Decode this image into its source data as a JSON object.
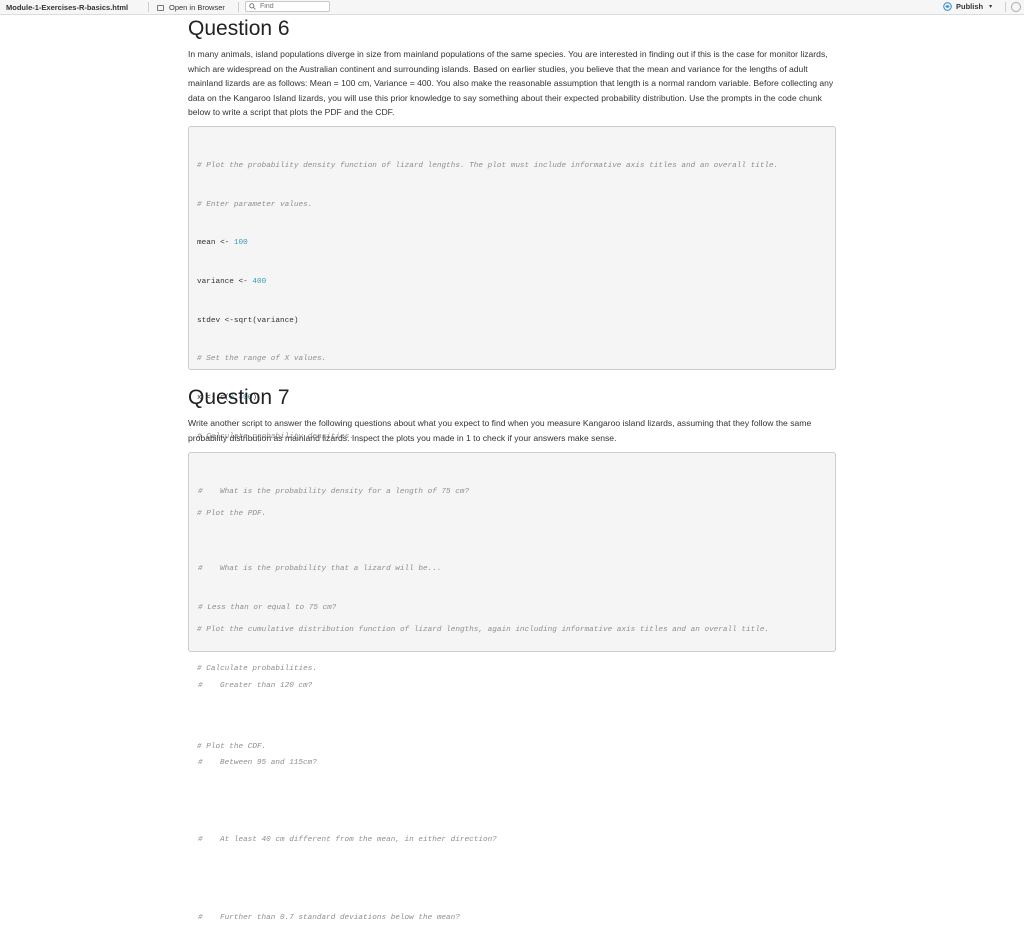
{
  "toolbar": {
    "filename": "Module-1-Exercises-R-basics.html",
    "open_in_browser": "Open in Browser",
    "find_placeholder": "Find",
    "publish": "Publish",
    "publish_caret": "▾"
  },
  "q6": {
    "title": "Question 6",
    "text": "In many animals, island populations diverge in size from mainland populations of the same species. You are interested in finding out if this is the case for monitor lizards, which are widespread on the Australian continent and surrounding islands. Based on earlier studies, you believe that the mean and variance for the lengths of adult mainland lizards are as follows: Mean = 100 cm, Variance = 400. You also make the reasonable assumption that length is a normal random variable. Before collecting any data on the Kangaroo Island lizards, you will use this prior knowledge to say something about their expected probability distribution. Use the prompts in the code chunk below to write a script that plots the PDF and the CDF.",
    "code": {
      "c1": "# Plot the probability density function of lizard lengths. The plot must include informative axis titles and an overall title.",
      "c2": "# Enter parameter values.",
      "mean_code": "mean <- ",
      "mean_val": "100",
      "var_code": "variance <- ",
      "var_val": "400",
      "stdev": "stdev <-sqrt(variance)",
      "c3": "# Set the range of X values.",
      "x_code": "x <- c(",
      "x_a": "0",
      "x_sep": ",",
      "x_b": "400",
      "x_end": ")",
      "c4": "# Calculate probability densities.",
      "c5": "# Plot the PDF.",
      "c6": "# Plot the cumulative distribution function of lizard lengths, again including informative axis titles and an overall title.",
      "c7": "# Calculate probabilities.",
      "c8": "# Plot the CDF."
    }
  },
  "q7": {
    "title": "Question 7",
    "text": "Write another script to answer the following questions about what you expect to find when you measure Kangaroo island lizards, assuming that they follow the same probability distribution as mainland lizards. Inspect the plots you made in 1 to check if your answers make sense.",
    "code": {
      "hash": "#",
      "l1": "What is the probability density for a length of 75 cm?",
      "l2": "What is the probability that a lizard will be...",
      "l3": "# Less than or equal to 75 cm?",
      "l4": "Greater than 120 cm?",
      "l5": "Between 95 and 115cm?",
      "l6": "At least 40 cm different from the mean, in either direction?",
      "l7": "Further than 0.7 standard deviations below the mean?"
    }
  }
}
